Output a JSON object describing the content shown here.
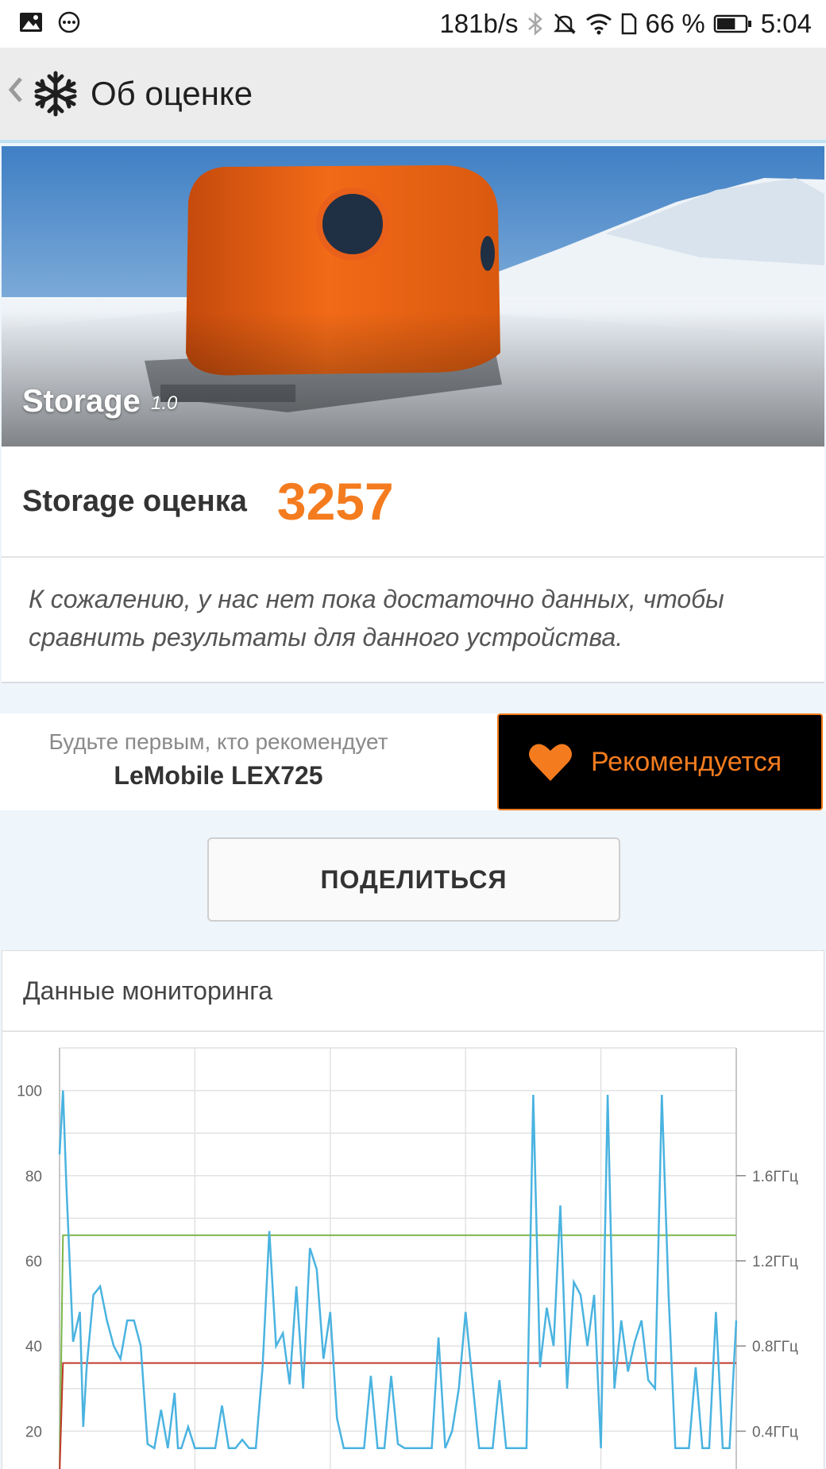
{
  "status_bar": {
    "net_speed": "181b/s",
    "battery_percent": "66 %",
    "battery_level": 0.66,
    "time": "5:04",
    "left_icons": [
      "image-icon",
      "chat-bubble-icon"
    ],
    "right_icons": [
      "bluetooth-icon",
      "mute-icon",
      "wifi-icon",
      "sim-icon",
      "battery-icon"
    ]
  },
  "app_bar": {
    "title": "Об оценке",
    "back_icon": "chevron-left-icon",
    "logo_icon": "snowflake-icon"
  },
  "hero": {
    "title": "Storage",
    "version": "1.0"
  },
  "score": {
    "label": "Storage оценка",
    "value": "3257",
    "accent_color": "#f47c1f"
  },
  "note": {
    "line1": "К сожалению, у нас нет пока достаточно данных, чтобы",
    "line2": "сравнить результаты для данного устройства."
  },
  "recommend": {
    "prompt": "Будьте первым, кто рекомендует",
    "device": "LeMobile LEX725",
    "button_label": "Рекомендуется",
    "icon": "heart-icon"
  },
  "share": {
    "label": "ПОДЕЛИТЬСЯ"
  },
  "monitoring": {
    "title": "Данные мониторинга"
  },
  "chart_data": {
    "type": "line",
    "title": "",
    "xlabel": "",
    "ylabel": "",
    "ylim": [
      10,
      110
    ],
    "yticks": [
      20,
      40,
      60,
      80,
      100
    ],
    "y2_ticks": [
      "0.4ГГц",
      "0.8ГГц",
      "1.2ГГц",
      "1.6ГГц"
    ],
    "y2_tick_values": [
      20,
      40,
      60,
      80
    ],
    "x_range": [
      0,
      200
    ],
    "grid": true,
    "legend": "none",
    "series": [
      {
        "color": "#4ab3e0",
        "x": [
          0,
          1,
          2,
          4,
          6,
          7,
          8,
          10,
          12,
          14,
          16,
          18,
          20,
          22,
          24,
          26,
          28,
          30,
          32,
          34,
          35,
          36,
          38,
          40,
          42,
          44,
          46,
          48,
          50,
          52,
          54,
          56,
          58,
          60,
          62,
          64,
          66,
          68,
          70,
          72,
          74,
          76,
          78,
          80,
          82,
          84,
          86,
          88,
          90,
          92,
          94,
          96,
          98,
          100,
          102,
          104,
          106,
          108,
          110,
          112,
          114,
          116,
          118,
          120,
          122,
          124,
          126,
          128,
          130,
          132,
          134,
          136,
          138,
          140,
          142,
          144,
          146,
          148,
          150,
          152,
          154,
          156,
          158,
          160,
          162,
          164,
          166,
          168,
          170,
          172,
          174,
          176,
          178,
          180,
          182,
          184,
          186,
          188,
          190,
          192,
          194,
          196,
          198,
          200
        ],
        "y": [
          85,
          100,
          78,
          41,
          48,
          21,
          35,
          52,
          54,
          46,
          40,
          37,
          46,
          46,
          40,
          17,
          16,
          25,
          16,
          29,
          16,
          16,
          21,
          16,
          16,
          16,
          16,
          26,
          16,
          16,
          18,
          16,
          16,
          35,
          67,
          40,
          43,
          31,
          54,
          30,
          63,
          58,
          37,
          48,
          23,
          16,
          16,
          16,
          16,
          33,
          16,
          16,
          33,
          17,
          16,
          16,
          16,
          16,
          16,
          42,
          16,
          20,
          30,
          48,
          32,
          16,
          16,
          16,
          32,
          16,
          16,
          16,
          16,
          99,
          35,
          49,
          40,
          73,
          30,
          55,
          52,
          40,
          52,
          16,
          99,
          30,
          46,
          34,
          41,
          46,
          32,
          30,
          99,
          52,
          16,
          16,
          16,
          35,
          16,
          16,
          48,
          16,
          16,
          46
        ]
      },
      {
        "color": "#7ab648",
        "x": [
          0,
          1,
          2,
          200
        ],
        "y": [
          10,
          66,
          66,
          66
        ]
      },
      {
        "color": "#c0392b",
        "x": [
          0,
          1,
          2,
          200
        ],
        "y": [
          10,
          36,
          36,
          36
        ]
      }
    ]
  }
}
